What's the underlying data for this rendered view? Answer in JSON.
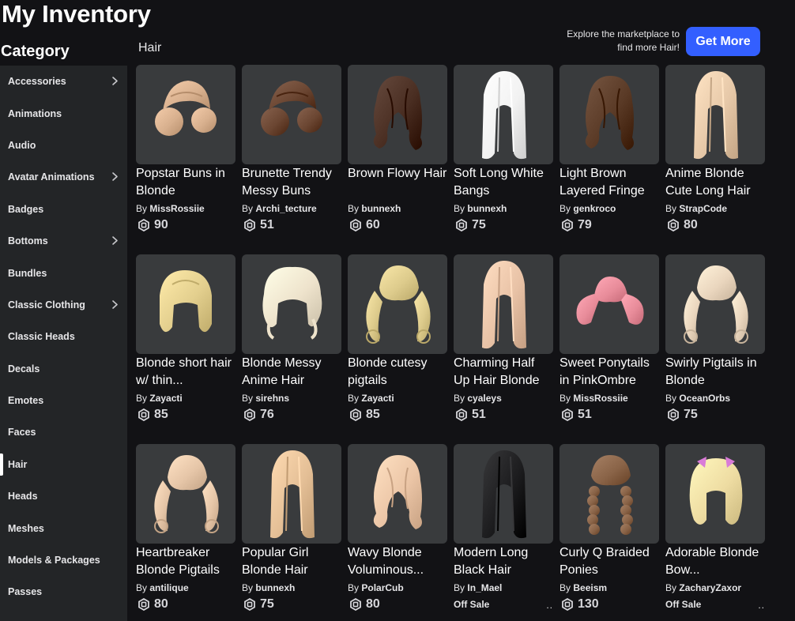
{
  "header": {
    "title": "My Inventory"
  },
  "sidebar": {
    "title": "Category",
    "items": [
      {
        "label": "Accessories",
        "chevron": true,
        "active": false
      },
      {
        "label": "Animations",
        "chevron": false,
        "active": false
      },
      {
        "label": "Audio",
        "chevron": false,
        "active": false
      },
      {
        "label": "Avatar Animations",
        "chevron": true,
        "active": false
      },
      {
        "label": "Badges",
        "chevron": false,
        "active": false
      },
      {
        "label": "Bottoms",
        "chevron": true,
        "active": false
      },
      {
        "label": "Bundles",
        "chevron": false,
        "active": false
      },
      {
        "label": "Classic Clothing",
        "chevron": true,
        "active": false
      },
      {
        "label": "Classic Heads",
        "chevron": false,
        "active": false
      },
      {
        "label": "Decals",
        "chevron": false,
        "active": false
      },
      {
        "label": "Emotes",
        "chevron": false,
        "active": false
      },
      {
        "label": "Faces",
        "chevron": false,
        "active": false
      },
      {
        "label": "Hair",
        "chevron": false,
        "active": true
      },
      {
        "label": "Heads",
        "chevron": false,
        "active": false
      },
      {
        "label": "Meshes",
        "chevron": false,
        "active": false
      },
      {
        "label": "Models & Packages",
        "chevron": false,
        "active": false
      },
      {
        "label": "Passes",
        "chevron": false,
        "active": false
      }
    ]
  },
  "main": {
    "section_label": "Hair",
    "promo_line1": "Explore the marketplace to",
    "promo_line2": "find more Hair!",
    "get_more_label": "Get More",
    "by_prefix": "By",
    "items": [
      {
        "name": "Popstar Buns in Blonde",
        "creator": "MissRossiie",
        "price": "90",
        "color": "#d8b08e",
        "style": "buns"
      },
      {
        "name": "Brunette Trendy Messy Buns",
        "creator": "Archi_tecture",
        "price": "51",
        "color": "#6b4632",
        "style": "buns"
      },
      {
        "name": "Brown Flowy Hair",
        "creator": "bunnexh",
        "price": "60",
        "color": "#4a2e22",
        "style": "wavy"
      },
      {
        "name": "Soft Long White Bangs",
        "creator": "bunnexh",
        "price": "75",
        "color": "#f2f2f2",
        "style": "long"
      },
      {
        "name": "Light Brown Layered Fringe",
        "creator": "genkroco",
        "price": "79",
        "color": "#5a3a26",
        "style": "wavy"
      },
      {
        "name": "Anime Blonde Cute Long Hair",
        "creator": "StrapCode",
        "price": "80",
        "color": "#e6c8a8",
        "style": "long"
      },
      {
        "name": "Blonde short hair w/ thin...",
        "creator": "Zayacti",
        "price": "85",
        "color": "#e3cf8e",
        "style": "short"
      },
      {
        "name": "Blonde Messy Anime Hair",
        "creator": "sirehns",
        "price": "76",
        "color": "#eee3cc",
        "style": "messy"
      },
      {
        "name": "Blonde cutesy pigtails",
        "creator": "Zayacti",
        "price": "85",
        "color": "#ddcb8c",
        "style": "pigtails"
      },
      {
        "name": "Charming Half Up Hair Blonde",
        "creator": "cyaleys",
        "price": "51",
        "color": "#e8c2a6",
        "style": "long"
      },
      {
        "name": "Sweet Ponytails in PinkOmbre",
        "creator": "MissRossiie",
        "price": "51",
        "color": "#e88c9a",
        "style": "ponytails"
      },
      {
        "name": "Swirly Pigtails in Blonde",
        "creator": "OceanOrbs",
        "price": "75",
        "color": "#ead6be",
        "style": "pigtails"
      },
      {
        "name": "Heartbreaker Blonde Pigtails",
        "creator": "antilique",
        "price": "80",
        "color": "#e6c6a8",
        "style": "pigtails"
      },
      {
        "name": "Popular Girl Blonde Hair",
        "creator": "bunnexh",
        "price": "75",
        "color": "#e4bf96",
        "style": "long"
      },
      {
        "name": "Wavy Blonde Voluminous...",
        "creator": "PolarCub",
        "price": "80",
        "color": "#ebc5a6",
        "style": "wavy"
      },
      {
        "name": "Modern Long Black Hair",
        "creator": "In_Mael",
        "price": "Off Sale",
        "offsale": true,
        "color": "#1c1c1e",
        "style": "long"
      },
      {
        "name": "Curly Q Braided Ponies",
        "creator": "Beeism",
        "price": "130",
        "color": "#8a6448",
        "style": "braids"
      },
      {
        "name": "Adorable Blonde Bow...",
        "creator": "ZacharyZaxor",
        "price": "Off Sale",
        "offsale": true,
        "color": "#eedca2",
        "style": "bow"
      }
    ]
  }
}
